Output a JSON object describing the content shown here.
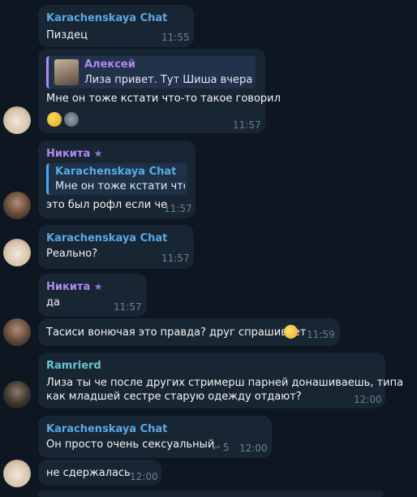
{
  "colors": {
    "background": "#0e1621",
    "bubble": "#182533",
    "karachenskaya": "#5aa9e6",
    "alexey": "#b18af0",
    "nikita": "#b18af0",
    "ramrierd": "#64c7d0",
    "time": "#6d7f8f"
  },
  "messages": [
    {
      "sender": "Karachenskaya Chat",
      "text": "Пиздец",
      "time": "11:55"
    },
    {
      "reply": {
        "name": "Алексей",
        "text": "Лиза привет. Тут Шиша вчера т..."
      },
      "text": "Мне он тоже кстати что-то такое говорил",
      "time": "11:57",
      "reactions": [
        "grinning-face-with-sweat",
        "sticker-emoji"
      ]
    },
    {
      "sender": "Никита",
      "reply": {
        "name": "Karachenskaya Chat",
        "text": "Мне он тоже кстати что..."
      },
      "text": "это был рофл если че",
      "time": "11:57"
    },
    {
      "sender": "Karachenskaya Chat",
      "text": "Реально?",
      "time": "11:57"
    },
    {
      "sender": "Никита",
      "text": "да",
      "time": "11:57"
    },
    {
      "text": "Тасиси вонючая это правда? друг спрашивает",
      "time": "11:59",
      "emoji": "thinking-face"
    },
    {
      "sender": "Ramrierd",
      "text_line1": "Лиза ты че после других стримерш парней донашиваешь, типа",
      "text_line2": "как младшей сестре старую одежду отдают?",
      "time": "12:00"
    },
    {
      "sender": "Karachenskaya Chat",
      "text": "Он просто очень сексуальный",
      "replies": "5",
      "time": "12:00"
    },
    {
      "text": "не сдержалась",
      "time": "12:00"
    }
  ]
}
